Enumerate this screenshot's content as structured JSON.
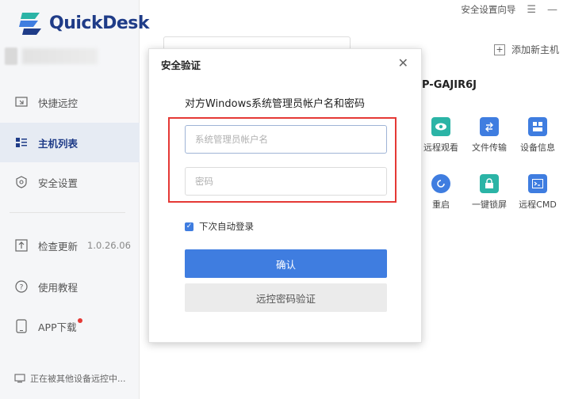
{
  "app": {
    "name": "QuickDesk"
  },
  "topbar": {
    "guide": "安全设置向导",
    "menu_icon": "menu-icon",
    "minimize_icon": "minimize-icon"
  },
  "sidebar": {
    "items": [
      {
        "label": "快捷远控",
        "icon": "remote-icon"
      },
      {
        "label": "主机列表",
        "icon": "list-icon",
        "active": true
      },
      {
        "label": "安全设置",
        "icon": "shield-icon"
      },
      {
        "label": "检查更新",
        "icon": "upload-icon",
        "version": "1.0.26.06"
      },
      {
        "label": "使用教程",
        "icon": "help-icon"
      },
      {
        "label": "APP下载",
        "icon": "phone-icon"
      }
    ],
    "status": "正在被其他设备远控中..."
  },
  "main": {
    "add_host": "添加新主机",
    "host_name": "P-GAJIR6J",
    "tools": [
      {
        "label": "远程观看",
        "color": "#2bb4a6"
      },
      {
        "label": "文件传输",
        "color": "#3f7de0"
      },
      {
        "label": "设备信息",
        "color": "#3f7de0"
      },
      {
        "label": "重启",
        "color": "#3f7de0"
      },
      {
        "label": "一键锁屏",
        "color": "#2bb4a6"
      },
      {
        "label": "远程CMD",
        "color": "#3f7de0"
      }
    ]
  },
  "dialog": {
    "title": "安全验证",
    "subtitle": "对方Windows系统管理员帐户名和密码",
    "username_placeholder": "系统管理员帐户名",
    "password_placeholder": "密码",
    "remember_label": "下次自动登录",
    "remember_checked": true,
    "confirm": "确认",
    "alt": "远控密码验证"
  },
  "colors": {
    "accent": "#3f7de0",
    "brand": "#1f3c88",
    "highlight": "#e53935"
  }
}
